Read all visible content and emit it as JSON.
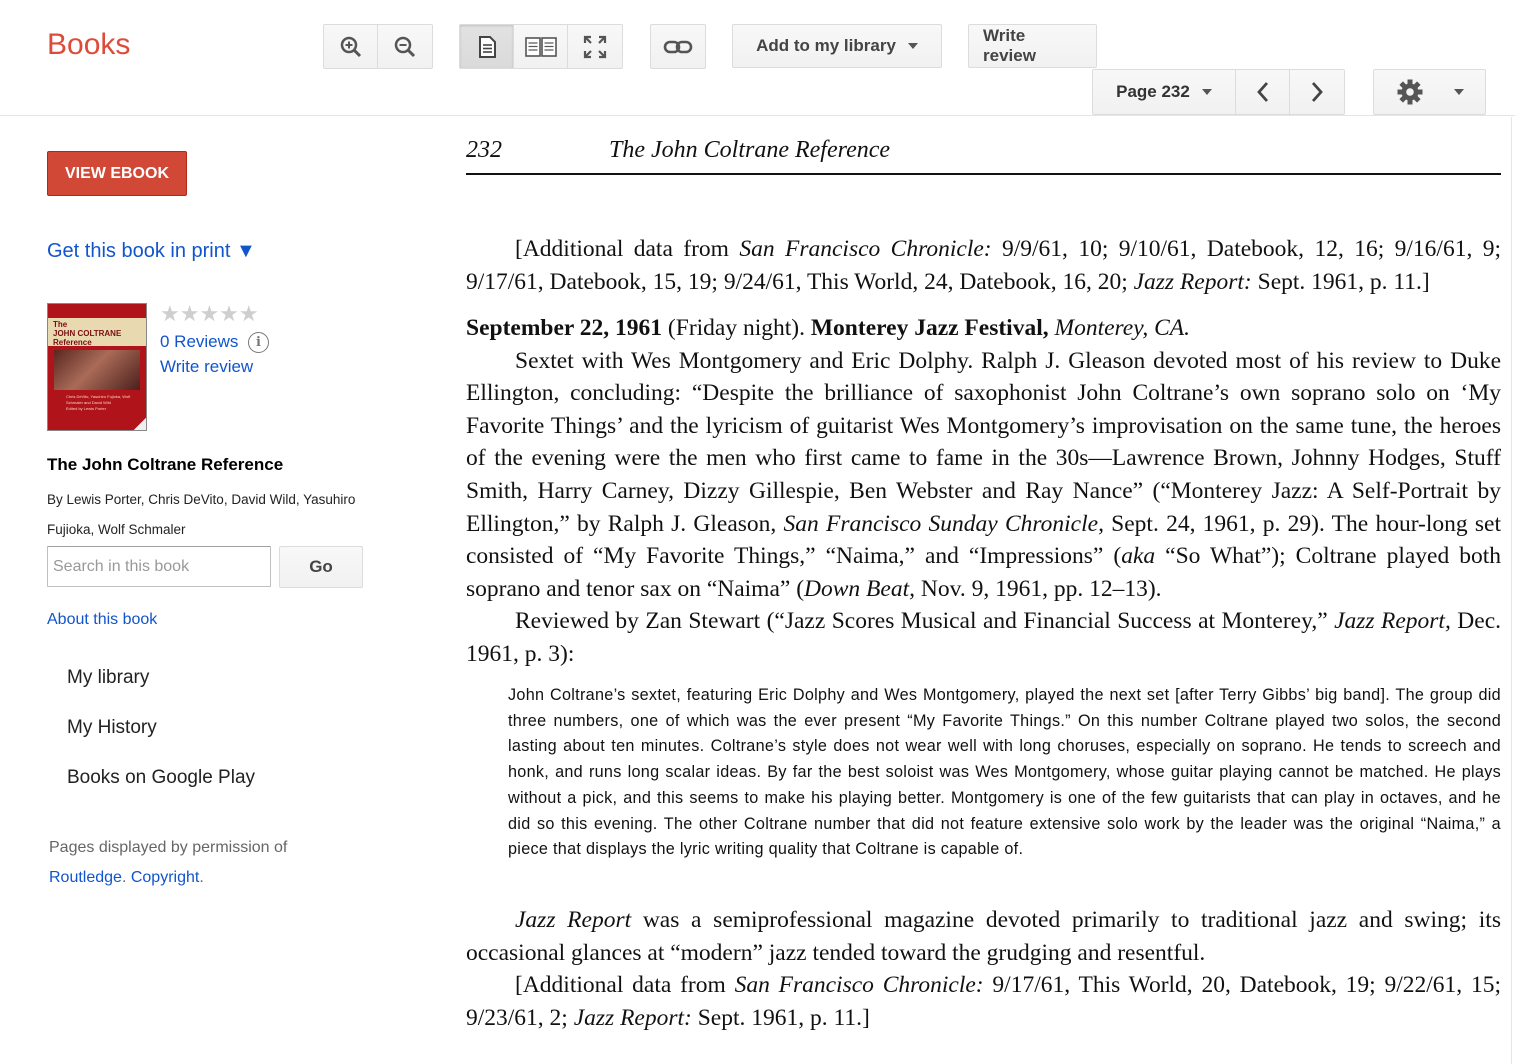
{
  "header": {
    "logo": "Books",
    "add_library_label": "Add to my library",
    "write_review_label": "Write review",
    "page_select_label": "Page 232"
  },
  "sidebar": {
    "view_ebook_label": "VIEW EBOOK",
    "get_print_label": "Get this book in print ▼",
    "rating_stars": "★★★★★",
    "rating_value": 0,
    "reviews_label": "0 Reviews",
    "write_review_label": "Write review",
    "cover": {
      "title_line1": "The",
      "title_line2": "JOHN COLTRANE",
      "title_line3": "Reference",
      "authors": "Chris DeVito, Yasuhiro Fujioka, Wolf Schmaler and David Wild",
      "editor": "Edited by Lewis Porter"
    },
    "book_title": "The John Coltrane Reference",
    "book_authors": "By Lewis Porter, Chris DeVito, David Wild, Yasuhiro Fujioka, Wolf Schmaler",
    "search_placeholder": "Search in this book",
    "go_label": "Go",
    "about_label": "About this book",
    "nav_items": [
      "My library",
      "My History",
      "Books on Google Play"
    ],
    "permission_text": "Pages displayed by permission of",
    "publisher_link": "Routledge",
    "copyright_link": "Copyright"
  },
  "page": {
    "page_number": "232",
    "running_title": "The John Coltrane Reference",
    "para1": {
      "t1": "[Additional data from ",
      "i1": "San Francisco Chronicle:",
      "t2": " 9/9/61, 10; 9/10/61, Datebook, 12, 16; 9/16/61, 9; 9/17/61, Datebook, 15, 19; 9/24/61, This World, 24, Datebook, 16, 20; ",
      "i2": "Jazz Report:",
      "t3": " Sept. 1961, p. 11.]"
    },
    "entry": {
      "date": "September 22, 1961",
      "t1": " (Friday night). ",
      "event": "Monterey Jazz Festival,",
      "location": " Monterey, CA."
    },
    "para2": {
      "t1": "Sextet with Wes Montgomery and Eric Dolphy. Ralph J. Gleason devoted most of his review to Duke Ellington, concluding: “Despite the brilliance of saxophonist John Coltrane’s own soprano solo on ‘My Favorite Things’ and the lyricism of guitarist Wes Montgomery’s improvisation on the same tune, the heroes of the evening were the men who first came to fame in the 30s—Lawrence Brown, Johnny Hodges, Stuff Smith, Harry Carney, Dizzy Gillespie, Ben Webster and Ray Nance” (“Monterey Jazz: A Self-Portrait by Ellington,” by Ralph J. Gleason, ",
      "i1": "San Francisco Sunday Chronicle,",
      "t2": " Sept. 24, 1961, p. 29). The hour-long set consisted of “My Favorite Things,” “Naima,” and “Impressions” (",
      "i2": "aka",
      "t3": " “So What”); Coltrane played both soprano and tenor sax on “Naima” (",
      "i3": "Down Beat,",
      "t4": " Nov. 9, 1961, pp. 12–13)."
    },
    "para3": {
      "t1": "Reviewed by Zan Stewart (“Jazz Scores Musical and Financial Success at Monterey,” ",
      "i1": "Jazz Report,",
      "t2": " Dec. 1961, p. 3):"
    },
    "quote": "John Coltrane’s sextet, featuring Eric Dolphy and Wes Montgomery, played the next set [after Terry Gibbs’ big band]. The group did three numbers, one of which was the ever present “My Favorite Things.” On this number Coltrane played two solos, the second lasting about ten minutes. Coltrane’s style does not wear well with long choruses, especially on soprano. He tends to screech and honk, and runs long scalar ideas. By far the best soloist was Wes Montgomery, whose guitar playing cannot be matched. He plays without a pick, and this seems to make his playing better. Montgomery is one of the few guitarists that can play in octaves, and he did so this evening. The other Coltrane number that did not feature extensive solo work by the leader was the original “Naima,” a piece that displays the lyric writing quality that Coltrane is capable of.",
    "para4": {
      "i1": "Jazz Report",
      "t1": " was a semiprofessional magazine devoted primarily to traditional jazz and swing; its occasional glances at “modern” jazz tended toward the grudging and resentful."
    },
    "para5": {
      "t1": "[Additional data from ",
      "i1": "San Francisco Chronicle:",
      "t2": " 9/17/61, This World, 20, Datebook, 19; 9/22/61, 15; 9/23/61, 2; ",
      "i2": "Jazz Report:",
      "t3": " Sept. 1961, p. 11.]"
    }
  }
}
